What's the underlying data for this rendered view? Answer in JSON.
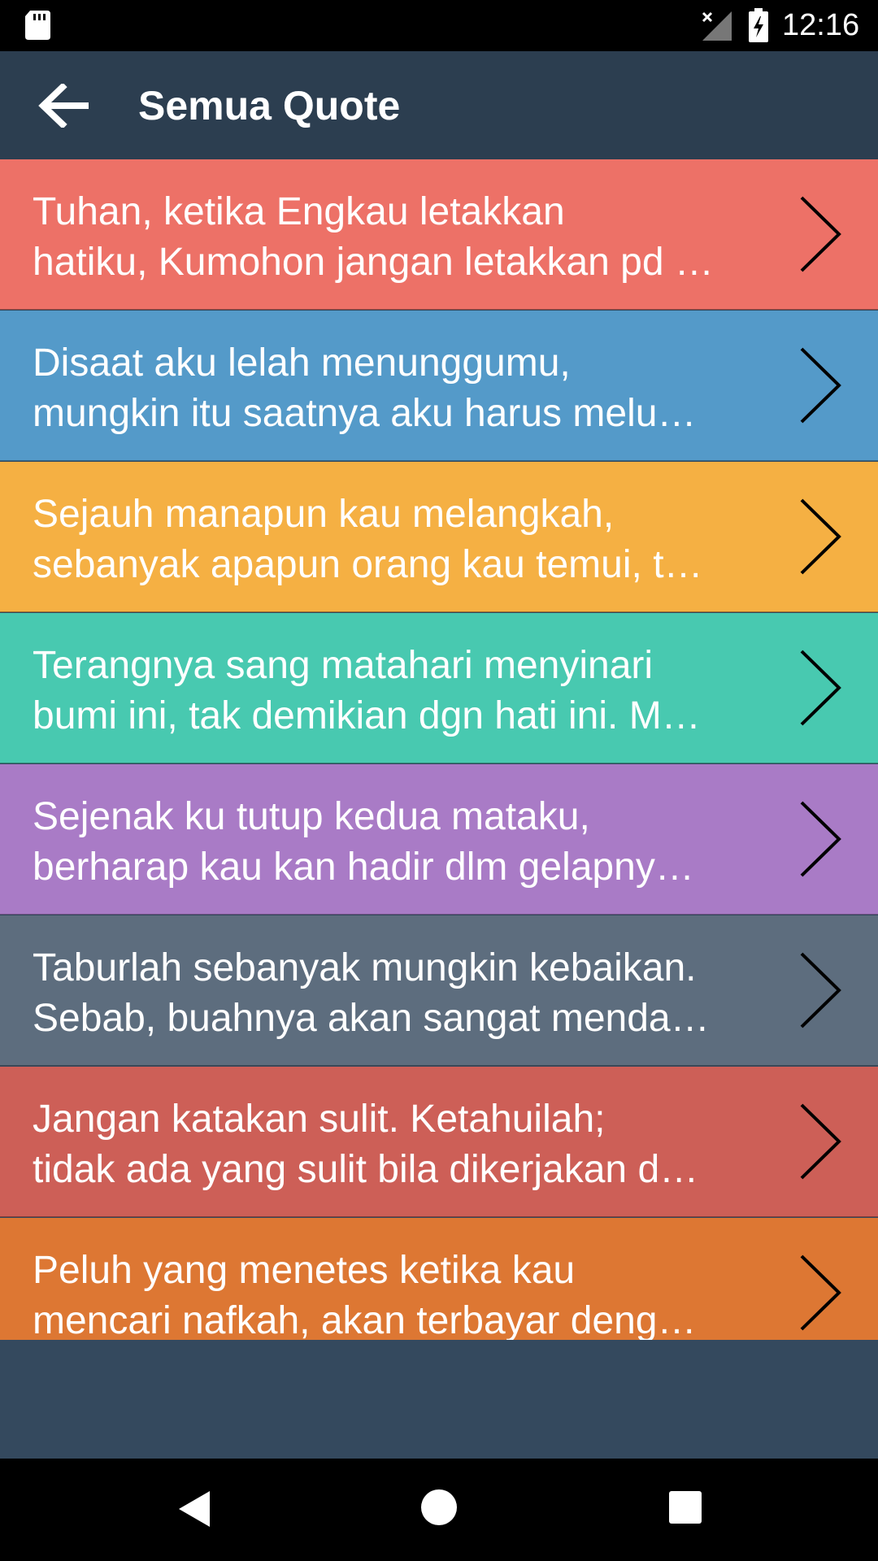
{
  "status_bar": {
    "time": "12:16"
  },
  "app_bar": {
    "title": "Semua Quote"
  },
  "quotes": [
    {
      "line1": "Tuhan, ketika Engkau letakkan",
      "line2": "hatiku, Kumohon jangan letakkan pd …",
      "color": "#ed7167"
    },
    {
      "line1": "Disaat aku lelah menunggumu,",
      "line2": "mungkin itu saatnya aku harus melu…",
      "color": "#549ac9"
    },
    {
      "line1": "Sejauh manapun kau melangkah,",
      "line2": "sebanyak apapun orang kau temui, t…",
      "color": "#f5b043"
    },
    {
      "line1": "Terangnya sang matahari menyinari",
      "line2": "bumi ini, tak demikian dgn hati ini. M…",
      "color": "#48c9b0"
    },
    {
      "line1": "Sejenak ku tutup kedua mataku,",
      "line2": "berharap kau kan hadir dlm gelapny…",
      "color": "#a97bc6"
    },
    {
      "line1": "Taburlah sebanyak mungkin kebaikan.",
      "line2": "Sebab, buahnya akan sangat menda…",
      "color": "#5d6d7e"
    },
    {
      "line1": "Jangan katakan sulit. Ketahuilah;",
      "line2": "tidak ada yang sulit bila dikerjakan d…",
      "color": "#cd5f57"
    },
    {
      "line1": "Peluh yang menetes ketika kau",
      "line2": "mencari nafkah, akan terbayar deng…",
      "color": "#dd7733"
    }
  ]
}
